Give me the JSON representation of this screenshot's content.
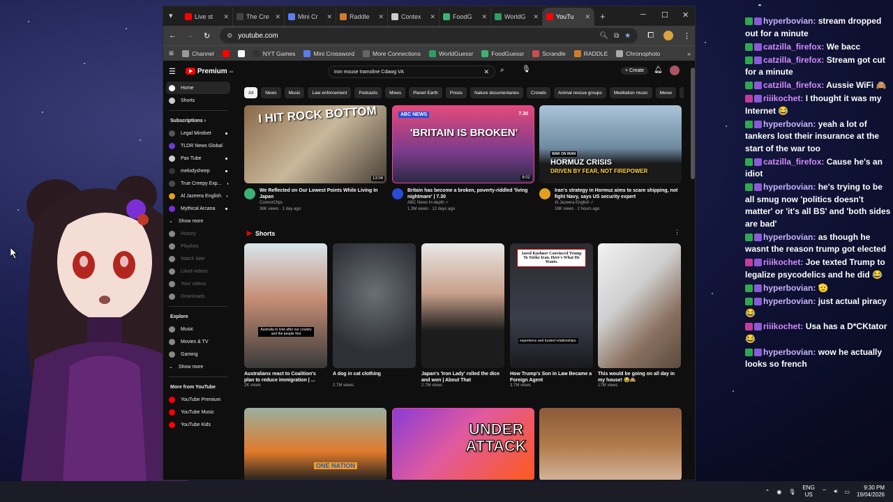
{
  "tabs": [
    {
      "label": "Live st",
      "color": "#ff0000"
    },
    {
      "label": "The Cre",
      "color": "#444444"
    },
    {
      "label": "Mini Cr",
      "color": "#5a7df0"
    },
    {
      "label": "Raddle",
      "color": "#d07b2c"
    },
    {
      "label": "Contex",
      "color": "#cccccc"
    },
    {
      "label": "FoodG",
      "color": "#3bb273"
    },
    {
      "label": "WorldG",
      "color": "#2f9e63"
    },
    {
      "label": "YouTu",
      "color": "#ff0000",
      "active": true
    }
  ],
  "address": "youtube.com",
  "bookmarks": [
    {
      "label": "Channel",
      "color": "#999999"
    },
    {
      "label": "",
      "color": "#ff0000"
    },
    {
      "label": "",
      "color": "#ffffff"
    },
    {
      "label": "NYT Games",
      "color": "#333333"
    },
    {
      "label": "Mini Crossword",
      "color": "#5a7df0"
    },
    {
      "label": "More Connections",
      "color": "#666666"
    },
    {
      "label": "WorldGuessr",
      "color": "#2f9e63"
    },
    {
      "label": "FoodGuessr",
      "color": "#3bb273"
    },
    {
      "label": "Scrandle",
      "color": "#c94d4d"
    },
    {
      "label": "RADDLE",
      "color": "#d07b2c"
    },
    {
      "label": "Chronophoto",
      "color": "#aaaaaa"
    }
  ],
  "youtube": {
    "logo": "Premium",
    "logo_sup": "AU",
    "search": "iron mouse tramoline Cdawg VA",
    "create": "Create",
    "chips": [
      "All",
      "News",
      "Music",
      "Law enforcement",
      "Podcasts",
      "Mixes",
      "Planet Earth",
      "Prices",
      "Nature documentaries",
      "Crowds",
      "Animal rescue groups",
      "Meditation music",
      "Meow",
      "Live"
    ],
    "sidebar": {
      "home": "Home",
      "shorts": "Shorts",
      "subscriptions": "Subscriptions",
      "subs": [
        "Legal Mindset",
        "TLDR News Global",
        "Pax Tube",
        "melodysheep",
        "True Creepy Exp...",
        "Al Jazeera English",
        "Mythical Arcana"
      ],
      "show_more": "Show more",
      "you_items": [
        "History",
        "Playlists",
        "Watch later",
        "Liked videos",
        "Your videos",
        "Downloads"
      ],
      "explore": "Explore",
      "explore_items": [
        "Music",
        "Movies & TV",
        "Gaming"
      ],
      "show_more2": "Show more",
      "more_from": "More from YouTube",
      "more_items": [
        "YouTube Premium",
        "YouTube Music",
        "YouTube Kids"
      ]
    },
    "videos": [
      {
        "title": "We Reflected on Our Lowest Points While Living In Japan",
        "channel": "ConnorClips",
        "meta": "36K views · 1 day ago",
        "duration": "13:04",
        "overlay": "I HIT ROCK BOTTOM"
      },
      {
        "title": "Britain has become a broken, poverty-riddled 'living nightmare' | 7.30",
        "channel": "ABC News In-depth ✓",
        "meta": "1.3M views · 12 days ago",
        "duration": "8:02",
        "overlay": "'BRITAIN IS BROKEN'",
        "badge": "ABC NEWS",
        "badge2": "7.30"
      },
      {
        "title": "Iran's strategy in Hormuz aims to scare shipping, not fight Navy, says US security expert",
        "channel": "Al Jazeera English ✓",
        "meta": "18K views · 2 hours ago",
        "duration": "",
        "overlay": "HORMUZ CRISIS",
        "overlay2": "DRIVEN BY FEAR, NOT FIREPOWER",
        "badge": "WAR ON IRAN"
      }
    ],
    "shorts_label": "Shorts",
    "shorts": [
      {
        "title": "Australians react to Coalition's plan to reduce immigration | ...",
        "views": "2K views",
        "caption": "Australia to look after our country and the people first"
      },
      {
        "title": "A dog in cat clothing",
        "views": "2.7M views"
      },
      {
        "title": "Japan's 'Iron Lady' rolled the dice and won | About That",
        "views": "2.7M views"
      },
      {
        "title": "How Trump's Son in Law Became a Foreign Agent",
        "views": "3.7M views",
        "overlay": "Jared Kushner Convinced Trump To Strike Iran. Here's What He Wants.",
        "caption": "experience and trusted relationships."
      },
      {
        "title": "This would be going on all day in my house! 😂🙈",
        "views": "17M views"
      }
    ],
    "row3_overlay": "UNDER ATTACK",
    "row3_badge": "ONE NATION"
  },
  "chat": [
    {
      "user": "hyperbovian:",
      "text": "stream dropped out for a minute",
      "cls": "hb"
    },
    {
      "user": "catzilla_firefox:",
      "text": "We bacc",
      "cls": "cf"
    },
    {
      "user": "catzilla_firefox:",
      "text": "Stream got cut for a minute",
      "cls": "cf"
    },
    {
      "user": "catzilla_firefox:",
      "text": "Aussie WiFi 🙈",
      "cls": "cf"
    },
    {
      "user": "riiikochet:",
      "text": "I thought it was my Internet 😂",
      "cls": "rk"
    },
    {
      "user": "hyperbovian:",
      "text": "yeah a lot of tankers lost their insurance at the start of the war too",
      "cls": "hb"
    },
    {
      "user": "catzilla_firefox:",
      "text": "Cause he's an idiot",
      "cls": "cf"
    },
    {
      "user": "hyperbovian:",
      "text": "he's trying to be all smug now 'politics doesn't matter' or 'it's all BS' and 'both sides are bad'",
      "cls": "hb"
    },
    {
      "user": "hyperbovian:",
      "text": "as though he wasnt the reason trump got elected",
      "cls": "hb"
    },
    {
      "user": "riiikochet:",
      "text": "Joe texted Trump to legalize psycodelics and he did 😂",
      "cls": "rk"
    },
    {
      "user": "hyperbovian:",
      "text": "🫡",
      "cls": "hb"
    },
    {
      "user": "hyperbovian:",
      "text": "just actual piracy 😂",
      "cls": "hb"
    },
    {
      "user": "riiikochet:",
      "text": "Usa has a D*CKtator 😂",
      "cls": "rk"
    },
    {
      "user": "hyperbovian:",
      "text": "wow he actually looks so french",
      "cls": "hb"
    }
  ],
  "taskbar": {
    "lang": "ENG",
    "region": "US",
    "time": "9:30 PM",
    "date": "19/04/2026"
  }
}
